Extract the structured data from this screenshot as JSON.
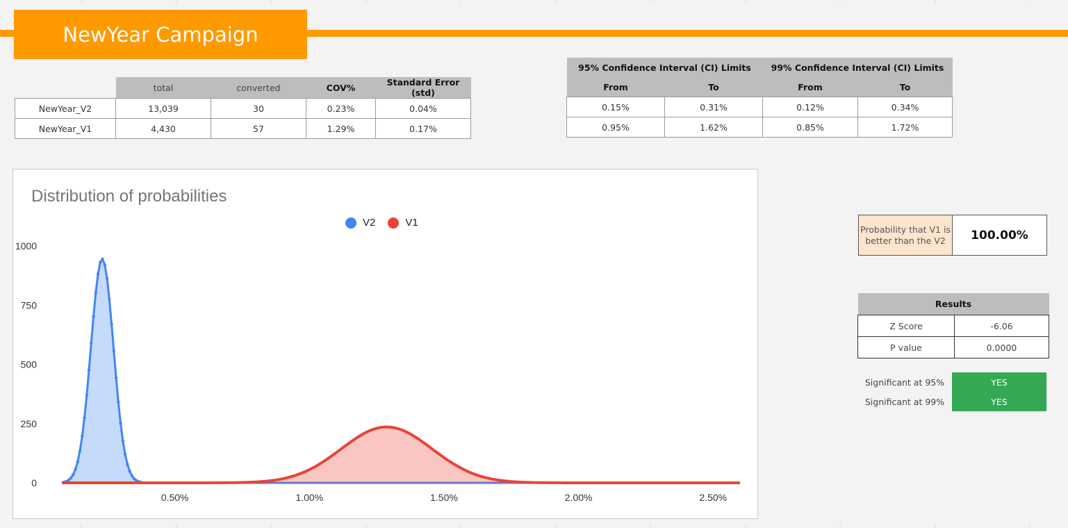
{
  "header": {
    "title": "NewYear Campaign"
  },
  "stats_table": {
    "columns": [
      "",
      "total",
      "converted",
      "COV%",
      "Standard Error (std)"
    ],
    "rows": [
      [
        "NewYear_V2",
        "13,039",
        "30",
        "0.23%",
        "0.04%"
      ],
      [
        "NewYear_V1",
        "4,430",
        "57",
        "1.29%",
        "0.17%"
      ]
    ]
  },
  "ci_table": {
    "group_headers": [
      "95% Confidence Interval (CI) Limits",
      "99% Confidence Interval (CI) Limits"
    ],
    "columns": [
      "From",
      "To",
      "From",
      "To"
    ],
    "rows": [
      [
        "0.15%",
        "0.31%",
        "0.12%",
        "0.34%"
      ],
      [
        "0.95%",
        "1.62%",
        "0.85%",
        "1.72%"
      ]
    ]
  },
  "probability": {
    "label": "Probability that V1 is better than the V2",
    "value": "100.00%"
  },
  "results": {
    "header": "Results",
    "rows": [
      [
        "Z Score",
        "-6.06"
      ],
      [
        "P value",
        "0.0000"
      ]
    ]
  },
  "significance": {
    "rows": [
      [
        "Significant at 95%",
        "YES"
      ],
      [
        "Significant at 99%",
        "YES"
      ]
    ],
    "color": "#34a853"
  },
  "colors": {
    "accent": "#ff9900",
    "v2": "#4285f4",
    "v1": "#ea4335"
  },
  "chart_data": {
    "type": "area",
    "title": "Distribution of probabilities",
    "xlabel": "",
    "ylabel": "",
    "xlim": [
      0.0008,
      0.026
    ],
    "ylim": [
      0,
      1000
    ],
    "y_ticks": [
      0,
      250,
      500,
      750,
      1000
    ],
    "x_ticks": [
      0.005,
      0.01,
      0.015,
      0.02,
      0.025
    ],
    "x_tick_labels": [
      "0.50%",
      "1.00%",
      "1.50%",
      "2.00%",
      "2.50%"
    ],
    "legend_position": "top-center",
    "series": [
      {
        "name": "V2",
        "color": "#4285f4",
        "mean": 0.0023,
        "std": 0.00042,
        "peak": 945
      },
      {
        "name": "V1",
        "color": "#ea4335",
        "mean": 0.01287,
        "std": 0.00169,
        "peak": 236
      }
    ]
  }
}
